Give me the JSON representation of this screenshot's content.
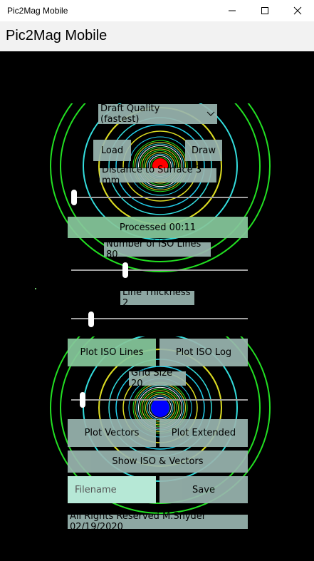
{
  "window": {
    "title": "Pic2Mag Mobile"
  },
  "app": {
    "header": "Pic2Mag Mobile"
  },
  "controls": {
    "quality": "Draft Quality (fastest)",
    "load": "Load",
    "draw": "Draw",
    "distance": "Distance to Surface  3 mm",
    "processed": "Processed 00:11",
    "iso_lines": "Number of ISO Lines  80",
    "line_thickness": "Line Thickness  2",
    "plot_iso_lines": "Plot ISO Lines",
    "plot_iso_log": "Plot ISO Log",
    "grid_size": "Grid Size  20",
    "plot_vectors": "Plot Vectors",
    "plot_extended": "Plot Extended",
    "show_iso_vectors": "Show ISO & Vectors",
    "filename_placeholder": "Filename",
    "save": "Save",
    "footer": "All Rights Reserved M.Snyder 02/19/2020"
  },
  "sliders": {
    "distance_level": 0.0,
    "iso_lines_level": 0.3,
    "line_thickness_level": 0.1,
    "grid_size_level": 0.05
  },
  "colors": {
    "button": "#86c79b",
    "label": "#9ab6b0",
    "pole_top": "#ff0000",
    "pole_bottom": "#0000ff"
  }
}
